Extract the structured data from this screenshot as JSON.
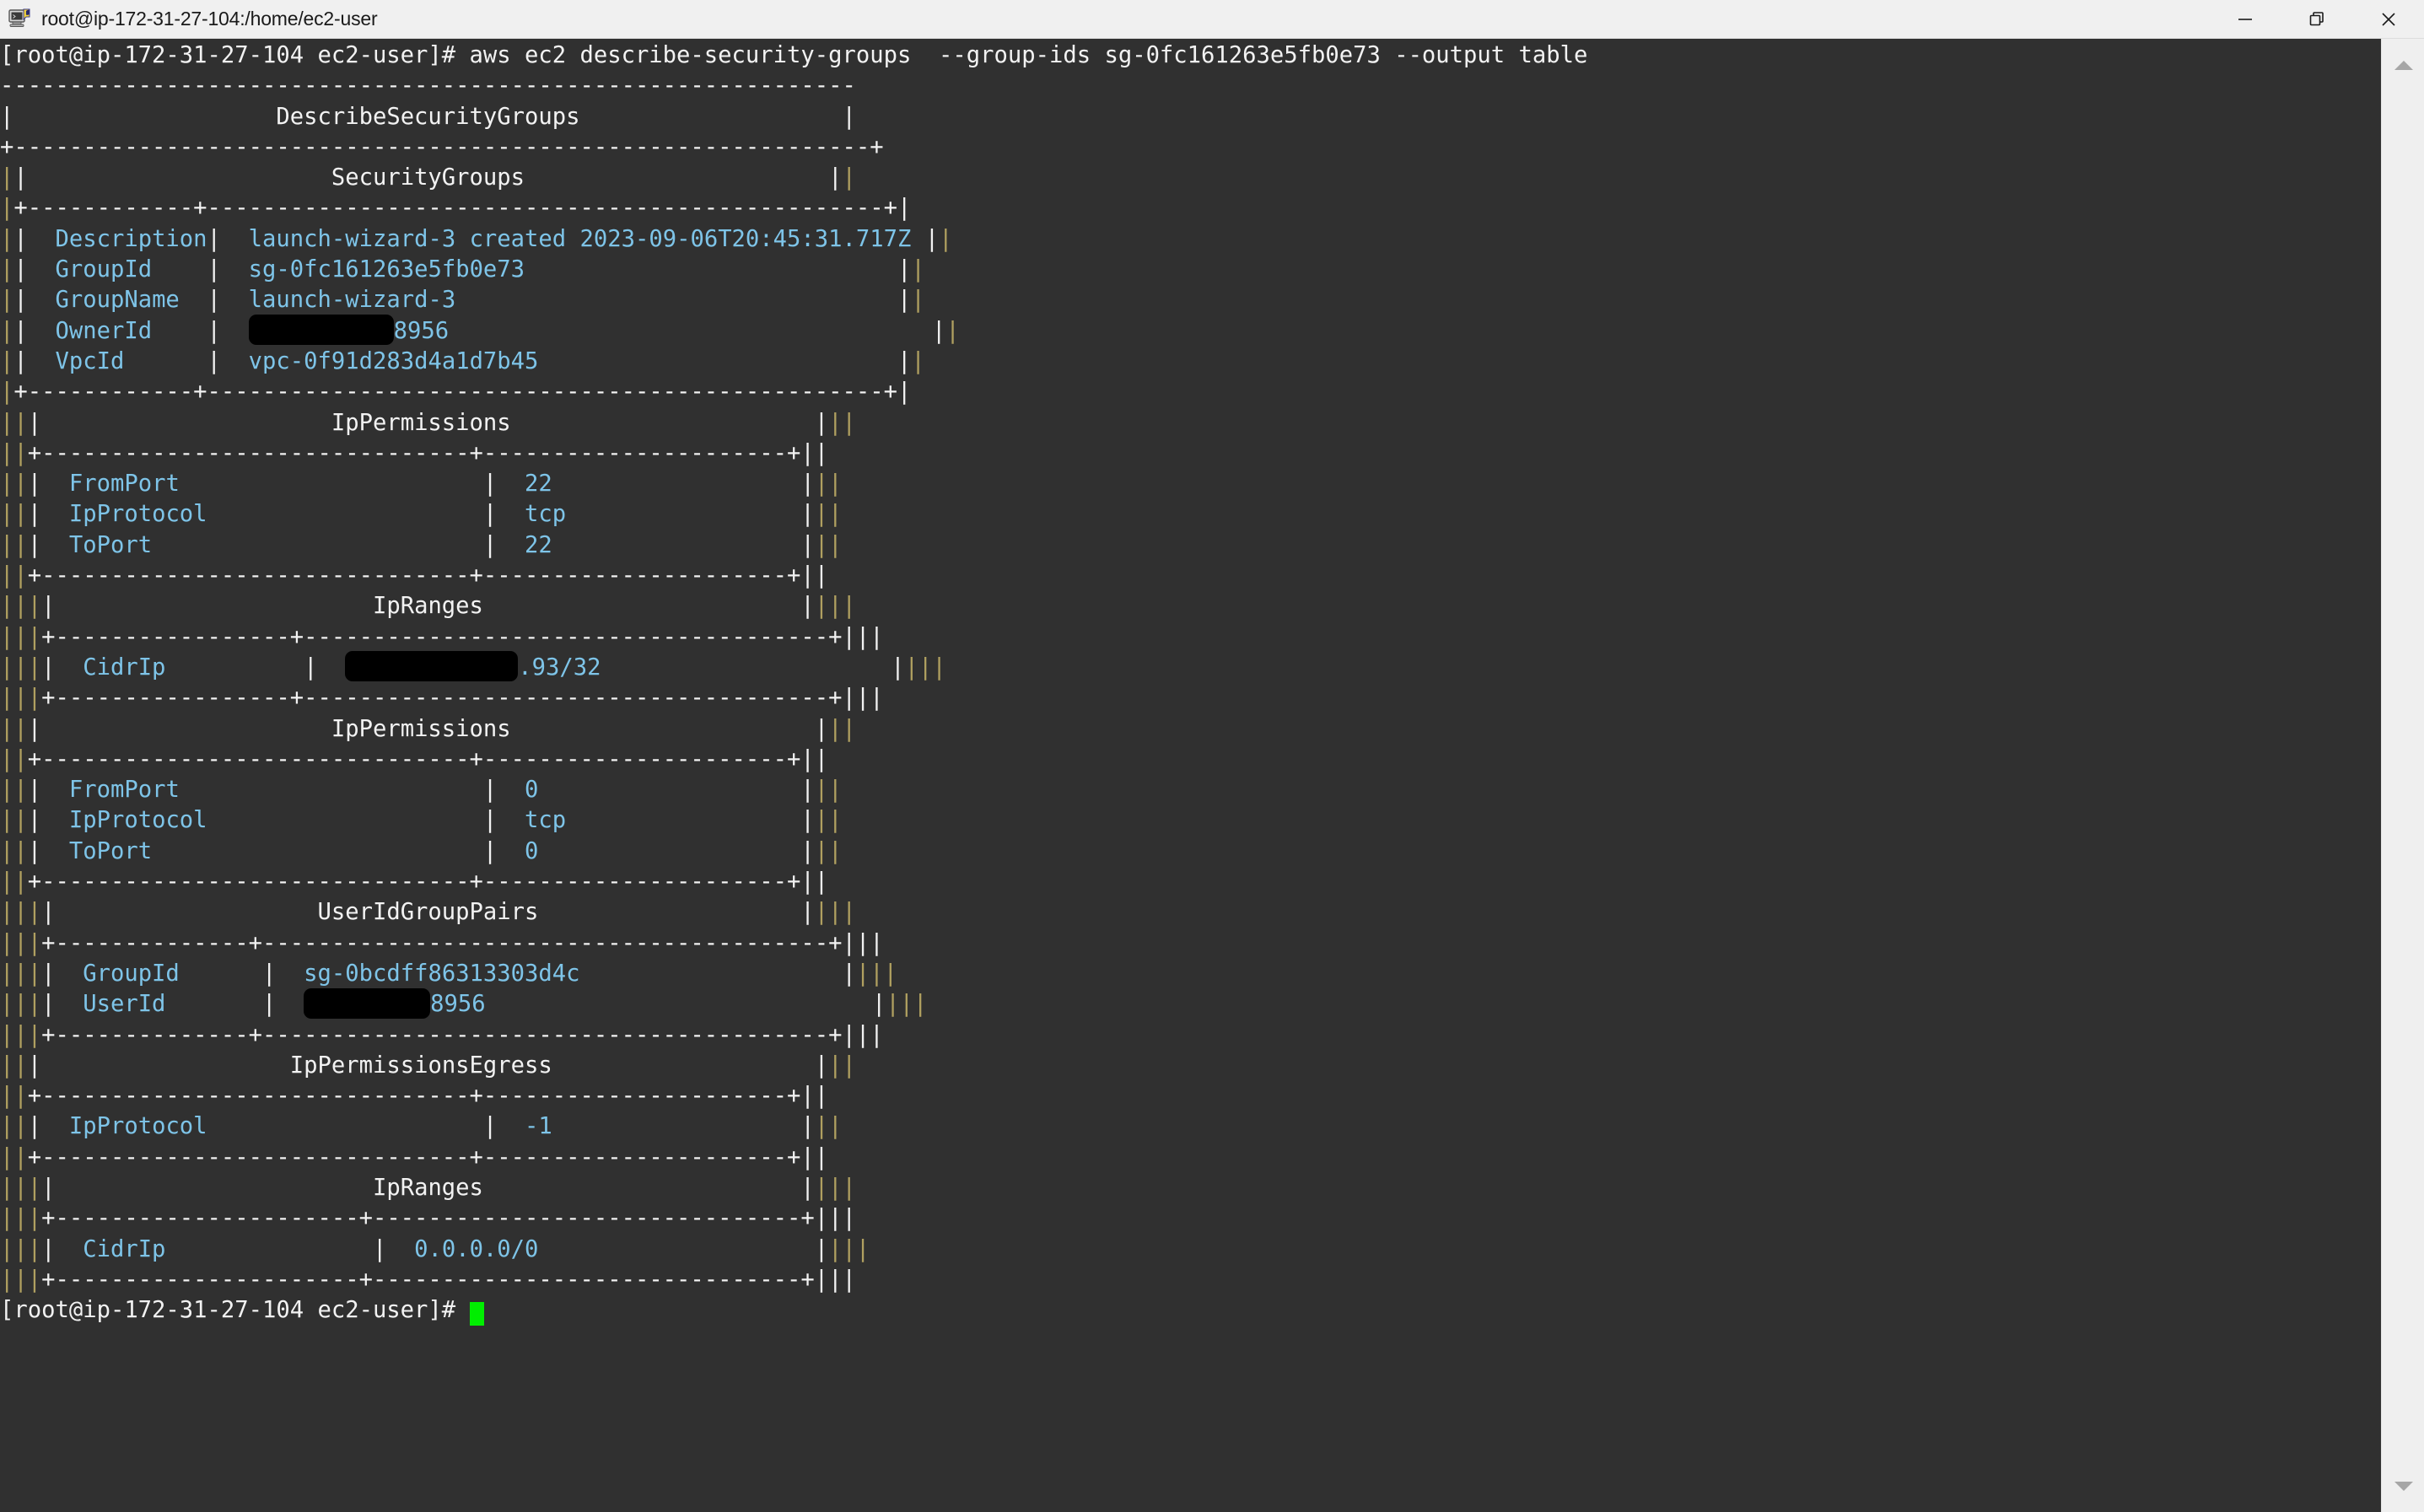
{
  "window": {
    "title": "root@ip-172-31-27-104:/home/ec2-user",
    "icon": "putty-terminal-icon",
    "minimize_label": "—",
    "maximize_label": "❐",
    "close_label": "✕"
  },
  "scrollbar": {
    "up_arrow": "scroll-up-arrow",
    "down_arrow": "scroll-down-arrow"
  },
  "terminal": {
    "prompt": "[root@ip-172-31-27-104 ec2-user]#",
    "command": " aws ec2 describe-security-groups  --group-ids sg-0fc161263e5fb0e73 --output table",
    "final_prompt": "[root@ip-172-31-27-104 ec2-user]#",
    "lines": [
      {
        "id": "cmd",
        "type": "command"
      },
      {
        "id": "l01",
        "type": "rule",
        "text": "--------------------------------------------------------------"
      },
      {
        "id": "l02",
        "type": "title",
        "left": "|",
        "text": "DescribeSecurityGroups",
        "right": "|"
      },
      {
        "id": "l03",
        "type": "rule",
        "text": "+--------------------------------------------------------------+"
      },
      {
        "id": "l04",
        "type": "title",
        "left": "||",
        "text": "SecurityGroups",
        "right": "||"
      },
      {
        "id": "l05",
        "type": "rule",
        "text": "|+------------+-------------------------------------------------+|"
      },
      {
        "id": "l06",
        "type": "kv",
        "bars": "||",
        "key": "Description",
        "value": "launch-wizard-3 created 2023-09-06T20:45:31.717Z",
        "right": "||"
      },
      {
        "id": "l07",
        "type": "kv",
        "bars": "||",
        "key": "GroupId",
        "value": "sg-0fc161263e5fb0e73",
        "right": "||"
      },
      {
        "id": "l08",
        "type": "kv",
        "bars": "||",
        "key": "GroupName",
        "value": "launch-wizard-3",
        "right": "||"
      },
      {
        "id": "l09",
        "type": "kv-redact",
        "bars": "||",
        "key": "OwnerId",
        "value": "8956",
        "redact": "owner",
        "right": "||"
      },
      {
        "id": "l10",
        "type": "kv",
        "bars": "||",
        "key": "VpcId",
        "value": "vpc-0f91d283d4a1d7b45",
        "right": "||"
      },
      {
        "id": "l11",
        "type": "rule",
        "text": "|+------------+-------------------------------------------------+|"
      },
      {
        "id": "l12",
        "type": "title",
        "left": "|||",
        "text": "IpPermissions",
        "right": "|||"
      },
      {
        "id": "l13",
        "type": "rule",
        "text": "||+-------------------------------+----------------------+||"
      },
      {
        "id": "l14",
        "type": "kv2",
        "bars": "|||",
        "key": "FromPort",
        "value": "22",
        "right": "|||"
      },
      {
        "id": "l15",
        "type": "kv2",
        "bars": "|||",
        "key": "IpProtocol",
        "value": "tcp",
        "right": "|||"
      },
      {
        "id": "l16",
        "type": "kv2",
        "bars": "|||",
        "key": "ToPort",
        "value": "22",
        "right": "|||"
      },
      {
        "id": "l17",
        "type": "rule",
        "text": "||+-------------------------------+----------------------+||"
      },
      {
        "id": "l18",
        "type": "title",
        "left": "||||",
        "text": "IpRanges",
        "right": "||||"
      },
      {
        "id": "l19",
        "type": "rule",
        "text": "|||+-----------------+--------------------------------------+|||"
      },
      {
        "id": "l20",
        "type": "kv3-redact",
        "bars": "||||",
        "key": "CidrIp",
        "value": ".93/32",
        "redact": "cidr",
        "right": "||||"
      },
      {
        "id": "l21",
        "type": "rule",
        "text": "|||+-----------------+--------------------------------------+|||"
      },
      {
        "id": "l22",
        "type": "title",
        "left": "|||",
        "text": "IpPermissions",
        "right": "|||"
      },
      {
        "id": "l23",
        "type": "rule",
        "text": "||+-------------------------------+----------------------+||"
      },
      {
        "id": "l24",
        "type": "kv2",
        "bars": "|||",
        "key": "FromPort",
        "value": "0",
        "right": "|||"
      },
      {
        "id": "l25",
        "type": "kv2",
        "bars": "|||",
        "key": "IpProtocol",
        "value": "tcp",
        "right": "|||"
      },
      {
        "id": "l26",
        "type": "kv2",
        "bars": "|||",
        "key": "ToPort",
        "value": "0",
        "right": "|||"
      },
      {
        "id": "l27",
        "type": "rule",
        "text": "||+-------------------------------+----------------------+||"
      },
      {
        "id": "l28",
        "type": "title",
        "left": "||||",
        "text": "UserIdGroupPairs",
        "right": "||||"
      },
      {
        "id": "l29",
        "type": "rule",
        "text": "|||+--------------+-----------------------------------------+|||"
      },
      {
        "id": "l30",
        "type": "kv4",
        "bars": "||||",
        "key": "GroupId",
        "value": "sg-0bcdff86313303d4c",
        "right": "||||"
      },
      {
        "id": "l31",
        "type": "kv4-redact",
        "bars": "||||",
        "key": "UserId",
        "value": "8956",
        "redact": "userid",
        "right": "||||"
      },
      {
        "id": "l32",
        "type": "rule",
        "text": "|||+--------------+-----------------------------------------+|||"
      },
      {
        "id": "l33",
        "type": "title",
        "left": "|||",
        "text": "IpPermissionsEgress",
        "right": "|||"
      },
      {
        "id": "l34",
        "type": "rule",
        "text": "||+-------------------------------+----------------------+||"
      },
      {
        "id": "l35",
        "type": "kv2",
        "bars": "|||",
        "key": "IpProtocol",
        "value": "-1",
        "right": "|||"
      },
      {
        "id": "l36",
        "type": "rule",
        "text": "||+-------------------------------+----------------------+||"
      },
      {
        "id": "l37",
        "type": "title",
        "left": "||||",
        "text": "IpRanges",
        "right": "||||"
      },
      {
        "id": "l38",
        "type": "rule",
        "text": "|||+----------------------+-------------------------------+|||"
      },
      {
        "id": "l39",
        "type": "kv5",
        "bars": "||||",
        "key": "CidrIp",
        "value": "0.0.0.0/0",
        "right": "||||"
      },
      {
        "id": "l40",
        "type": "rule",
        "text": "|||+----------------------+-------------------------------+|||"
      },
      {
        "id": "prompt",
        "type": "prompt"
      }
    ]
  },
  "security_group": {
    "Description": "launch-wizard-3 created 2023-09-06T20:45:31.717Z",
    "GroupId": "sg-0fc161263e5fb0e73",
    "GroupName": "launch-wizard-3",
    "OwnerId": "[REDACTED]8956",
    "VpcId": "vpc-0f91d283d4a1d7b45",
    "IpPermissions": [
      {
        "FromPort": "22",
        "IpProtocol": "tcp",
        "ToPort": "22",
        "IpRanges": [
          {
            "CidrIp": "[REDACTED].93/32"
          }
        ]
      },
      {
        "FromPort": "0",
        "IpProtocol": "tcp",
        "ToPort": "0",
        "UserIdGroupPairs": [
          {
            "GroupId": "sg-0bcdff86313303d4c",
            "UserId": "[REDACTED]8956"
          }
        ]
      }
    ],
    "IpPermissionsEgress": [
      {
        "IpProtocol": "-1",
        "IpRanges": [
          {
            "CidrIp": "0.0.0.0/0"
          }
        ]
      }
    ]
  },
  "colors": {
    "terminal_bg": "#303030",
    "text_white": "#f2f2f2",
    "text_blue": "#7ec4e8",
    "border_olive": "#b0a060",
    "cursor_green": "#00ee00",
    "titlebar_bg": "#f0f0f0"
  }
}
